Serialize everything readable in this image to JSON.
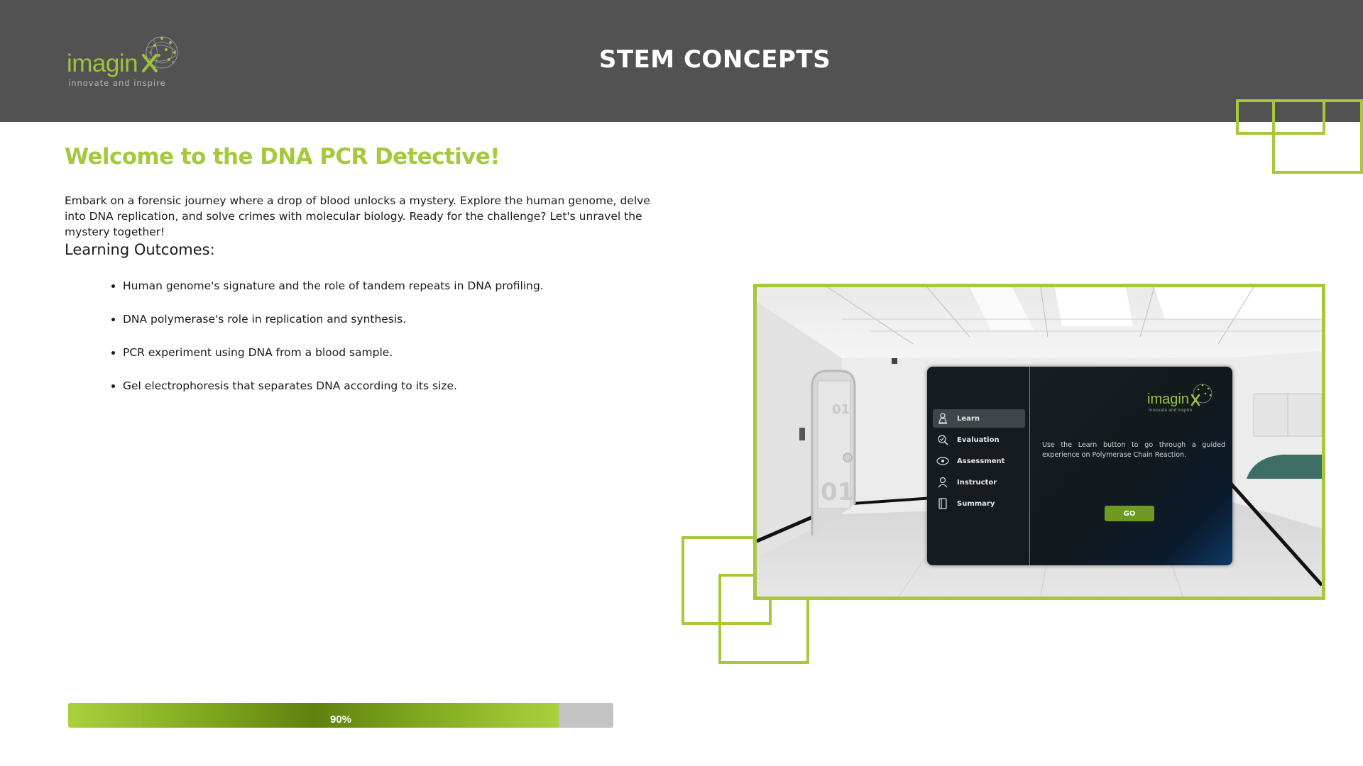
{
  "header": {
    "logo_word": "imagin",
    "logo_tagline": "innovate and inspire",
    "title": "STEM CONCEPTS"
  },
  "content": {
    "heading": "Welcome to the DNA PCR Detective!",
    "intro": "Embark on a forensic journey where a drop of blood unlocks a mystery. Explore the human genome, delve into DNA replication, and solve crimes with molecular biology. Ready for the challenge? Let's unravel the mystery together!",
    "learning_outcomes_heading": "Learning Outcomes:",
    "learning_outcomes": [
      "Human genome's signature and the role of tandem repeats in DNA profiling.",
      "DNA polymerase's role in replication and synthesis.",
      "PCR experiment using DNA from a blood sample.",
      "Gel electrophoresis that separates DNA according to its size."
    ]
  },
  "preview": {
    "door_labels": [
      "01",
      "01"
    ],
    "panel": {
      "menu": [
        {
          "label": "Learn",
          "icon": "learn-icon",
          "active": true
        },
        {
          "label": "Evaluation",
          "icon": "evaluation-icon",
          "active": false
        },
        {
          "label": "Assessment",
          "icon": "assessment-icon",
          "active": false
        },
        {
          "label": "Instructor",
          "icon": "instructor-icon",
          "active": false
        },
        {
          "label": "Summary",
          "icon": "summary-icon",
          "active": false
        }
      ],
      "logo_word": "imagin",
      "logo_tagline": "innovate and inspire",
      "description": "Use the Learn button to go through a guided experience on Polymerase Chain Reaction.",
      "go_label": "GO"
    }
  },
  "progress": {
    "value_percent": 90,
    "label": "90%"
  },
  "colors": {
    "accent": "#a6c83d",
    "header_bg": "#525252",
    "go_button": "#6e9a22"
  }
}
